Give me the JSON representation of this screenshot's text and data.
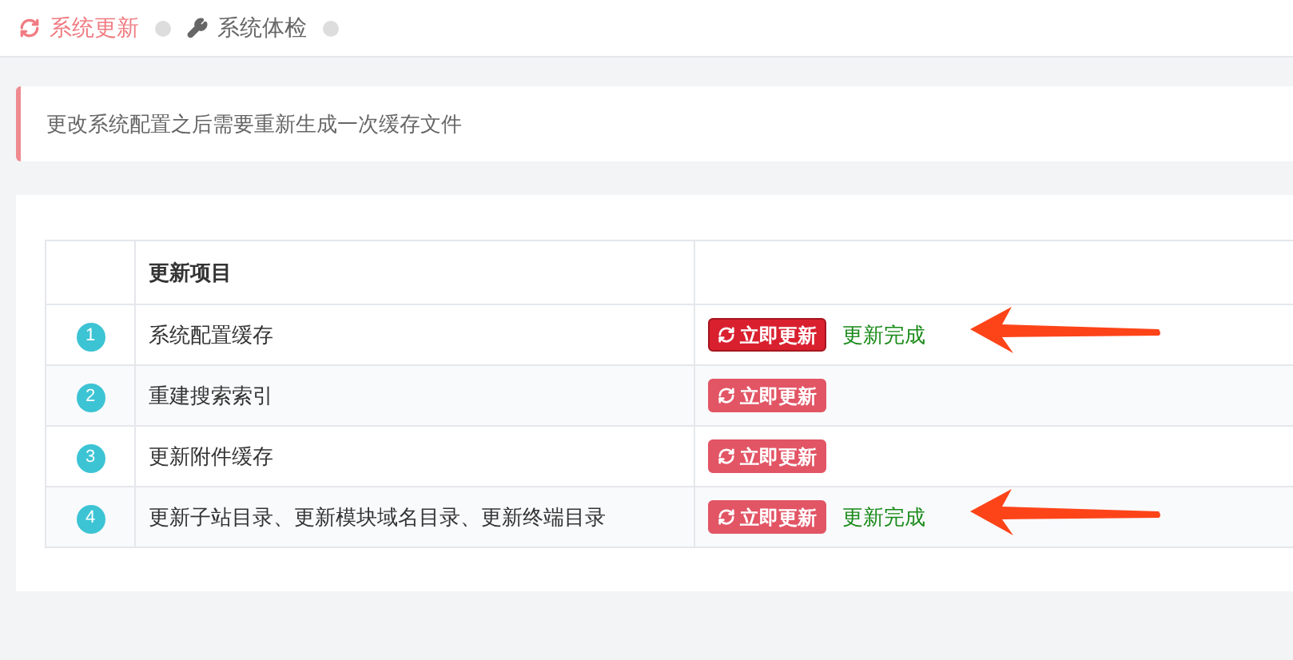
{
  "tabs": [
    {
      "label": "系统更新",
      "selected": true
    },
    {
      "label": "系统体检",
      "selected": false
    }
  ],
  "alert": {
    "text": "更改系统配置之后需要重新生成一次缓存文件"
  },
  "table": {
    "columns": [
      "更新项目"
    ],
    "rows": [
      {
        "number": "1",
        "item": "系统配置缓存",
        "button": "立即更新",
        "pressed": true,
        "status": "更新完成",
        "arrow": true
      },
      {
        "number": "2",
        "item": "重建搜索索引",
        "button": "立即更新",
        "pressed": false,
        "arrow": false
      },
      {
        "number": "3",
        "item": "更新附件缓存",
        "button": "立即更新",
        "pressed": false,
        "arrow": false
      },
      {
        "number": "4",
        "item": "更新子站目录、更新模块域名目录、更新终端目录",
        "button": "立即更新",
        "pressed": false,
        "status": "更新完成",
        "arrow": true
      }
    ]
  }
}
